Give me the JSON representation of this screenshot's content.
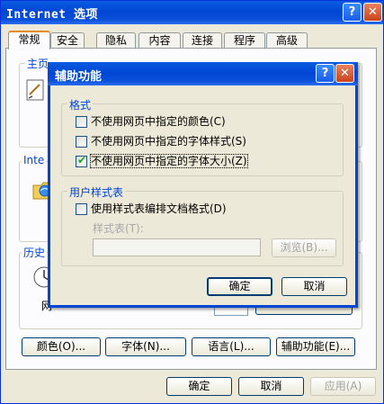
{
  "main_window": {
    "title": "Internet 选项",
    "help_glyph": "?",
    "close_glyph": "✕",
    "tabs": [
      "常规",
      "安全",
      "隐私",
      "内容",
      "连接",
      "程序",
      "高级"
    ],
    "groups": {
      "homepage": "主页",
      "temp_files": "Inte",
      "history": "历史"
    },
    "history_partial_label": "网",
    "buttons": {
      "colors": "颜色(O)...",
      "fonts": "字体(N)...",
      "languages": "语言(L)...",
      "accessibility": "辅助功能(E)...",
      "ok": "确定",
      "cancel": "取消",
      "apply": "应用(A)"
    }
  },
  "dialog": {
    "title": "辅助功能",
    "help_glyph": "?",
    "close_glyph": "✕",
    "format_group": {
      "legend": "格式",
      "options": [
        {
          "label": "不使用网页中指定的颜色(C)",
          "checked": false
        },
        {
          "label": "不使用网页中指定的字体样式(S)",
          "checked": false
        },
        {
          "label": "不使用网页中指定的字体大小(Z)",
          "checked": true
        }
      ]
    },
    "stylesheet_group": {
      "legend": "用户样式表",
      "option": {
        "label": "使用样式表编排文档格式(D)",
        "checked": false
      },
      "stylesheet_label": "样式表(T):",
      "stylesheet_value": "",
      "browse_button": "浏览(B)..."
    },
    "ok_button": "确定",
    "cancel_button": "取消"
  },
  "colors": {
    "title_blue": "#0046d5",
    "check_green": "#21a121",
    "dialog_bg": "#ece9d8"
  }
}
